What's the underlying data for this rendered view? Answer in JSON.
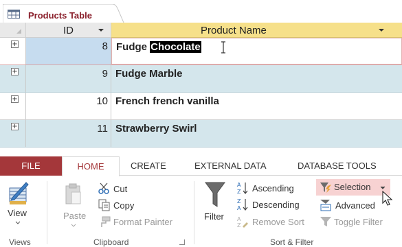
{
  "datasheet": {
    "tab_title": "Products Table",
    "columns": {
      "id": "ID",
      "name": "Product Name"
    },
    "expander_glyph": "+",
    "active_row": {
      "id": "8",
      "name_prefix": "Fudge ",
      "name_selected": "Chocolate"
    },
    "rows": [
      {
        "id": "9",
        "name": "Fudge Marble"
      },
      {
        "id": "10",
        "name": "French french vanilla"
      },
      {
        "id": "11",
        "name": "Strawberry Swirl"
      }
    ]
  },
  "ribbon": {
    "tabs": {
      "file": "FILE",
      "home": "HOME",
      "create": "CREATE",
      "external_data": "EXTERNAL DATA",
      "database_tools": "DATABASE TOOLS"
    },
    "views": {
      "view_label": "View",
      "group_label": "Views"
    },
    "clipboard": {
      "paste_label": "Paste",
      "cut_label": "Cut",
      "copy_label": "Copy",
      "format_painter_label": "Format Painter",
      "group_label": "Clipboard"
    },
    "sort_filter": {
      "filter_label": "Filter",
      "ascending_label": "Ascending",
      "descending_label": "Descending",
      "remove_sort_label": "Remove Sort",
      "selection_label": "Selection",
      "advanced_label": "Advanced",
      "toggle_filter_label": "Toggle Filter",
      "group_label": "Sort & Filter"
    }
  },
  "colors": {
    "file_tab": "#a4373a",
    "header_highlight": "#f6e08a",
    "alt_row": "#d4e6ec",
    "selection_highlight": "#f7d2d2"
  }
}
